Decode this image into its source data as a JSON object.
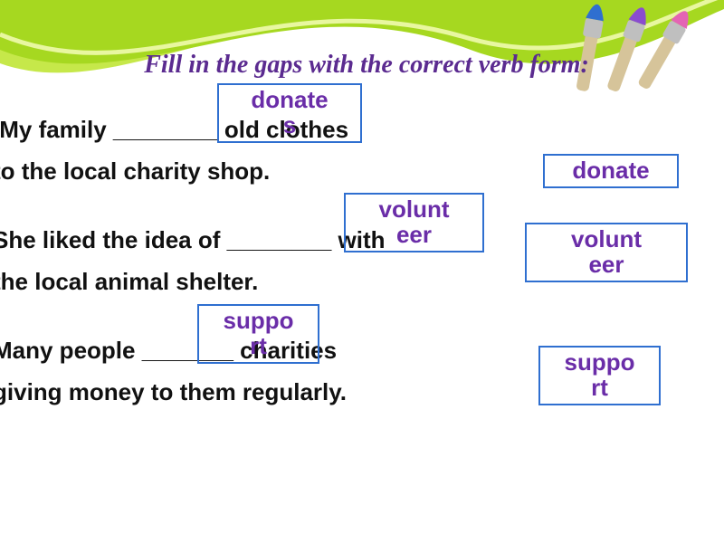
{
  "title": "Fill in the gaps with the correct verb form:",
  "sentences": {
    "s1_line1": ".My family ________ old clothes",
    "s1_line2": "to the local charity shop.",
    "s2_line1": " She liked the idea of ________ with",
    "s2_line2": "the local animal shelter.",
    "s3_line1": "Many people _______ charities",
    "s3_line2": " giving  money to them regularly."
  },
  "answers": {
    "a1": "donate\ns",
    "a2": "volunt\neer",
    "a3": "suppo\nrt"
  },
  "options": {
    "o1": "donate",
    "o2": "volunt\neer",
    "o3": "suppo\nrt"
  }
}
